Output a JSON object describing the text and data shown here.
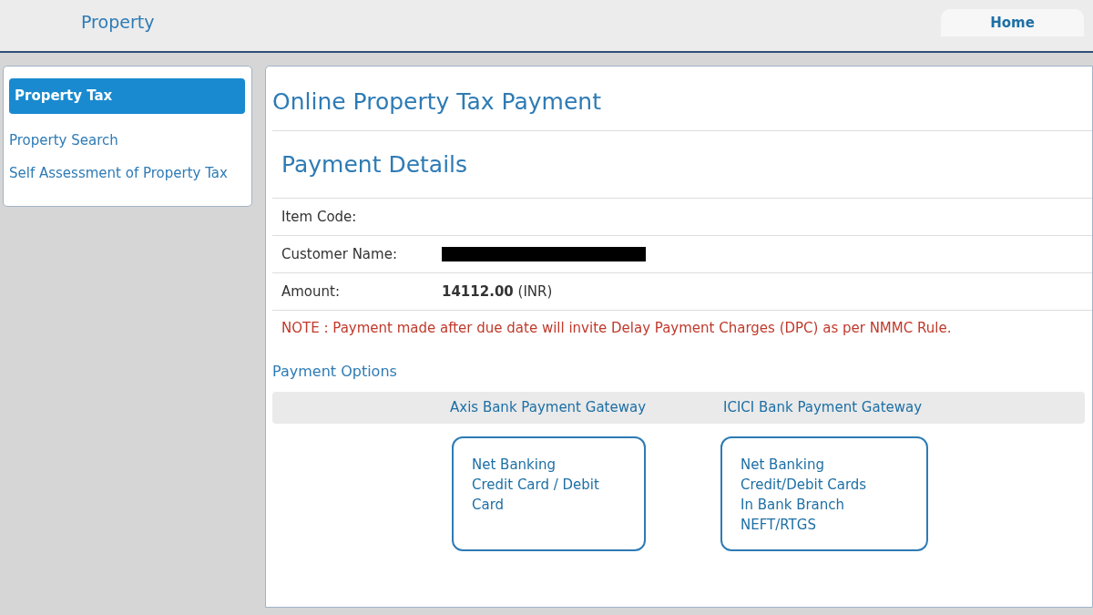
{
  "header": {
    "title": "Property",
    "home_link": "Home"
  },
  "sidebar": {
    "items": [
      {
        "label": "Property Tax",
        "selected": true
      },
      {
        "label": "Property Search",
        "selected": false
      },
      {
        "label": "Self Assessment of Property Tax",
        "selected": false
      }
    ]
  },
  "main": {
    "title": "Online Property Tax Payment",
    "section_title": "Payment Details",
    "details": [
      {
        "label": "Item Code:",
        "redacted": false
      },
      {
        "label": "Customer Name:",
        "redacted": true
      },
      {
        "label": "Amount:",
        "value": "**14112.00** (INR)",
        "redacted": false
      }
    ],
    "note": "NOTE : Payment made after due date will invite Delay Payment Charges (DPC) as per NMMC Rule.",
    "payment_options_title": "Payment Options",
    "gateways": [
      {
        "name": "Axis Bank Payment Gateway",
        "options": [
          "Net Banking",
          "Credit Card / Debit Card"
        ]
      },
      {
        "name": "ICICI Bank Payment Gateway",
        "options": [
          "Net Banking",
          "Credit/Debit Cards",
          "In Bank Branch",
          "NEFT/RTGS"
        ]
      }
    ]
  }
}
